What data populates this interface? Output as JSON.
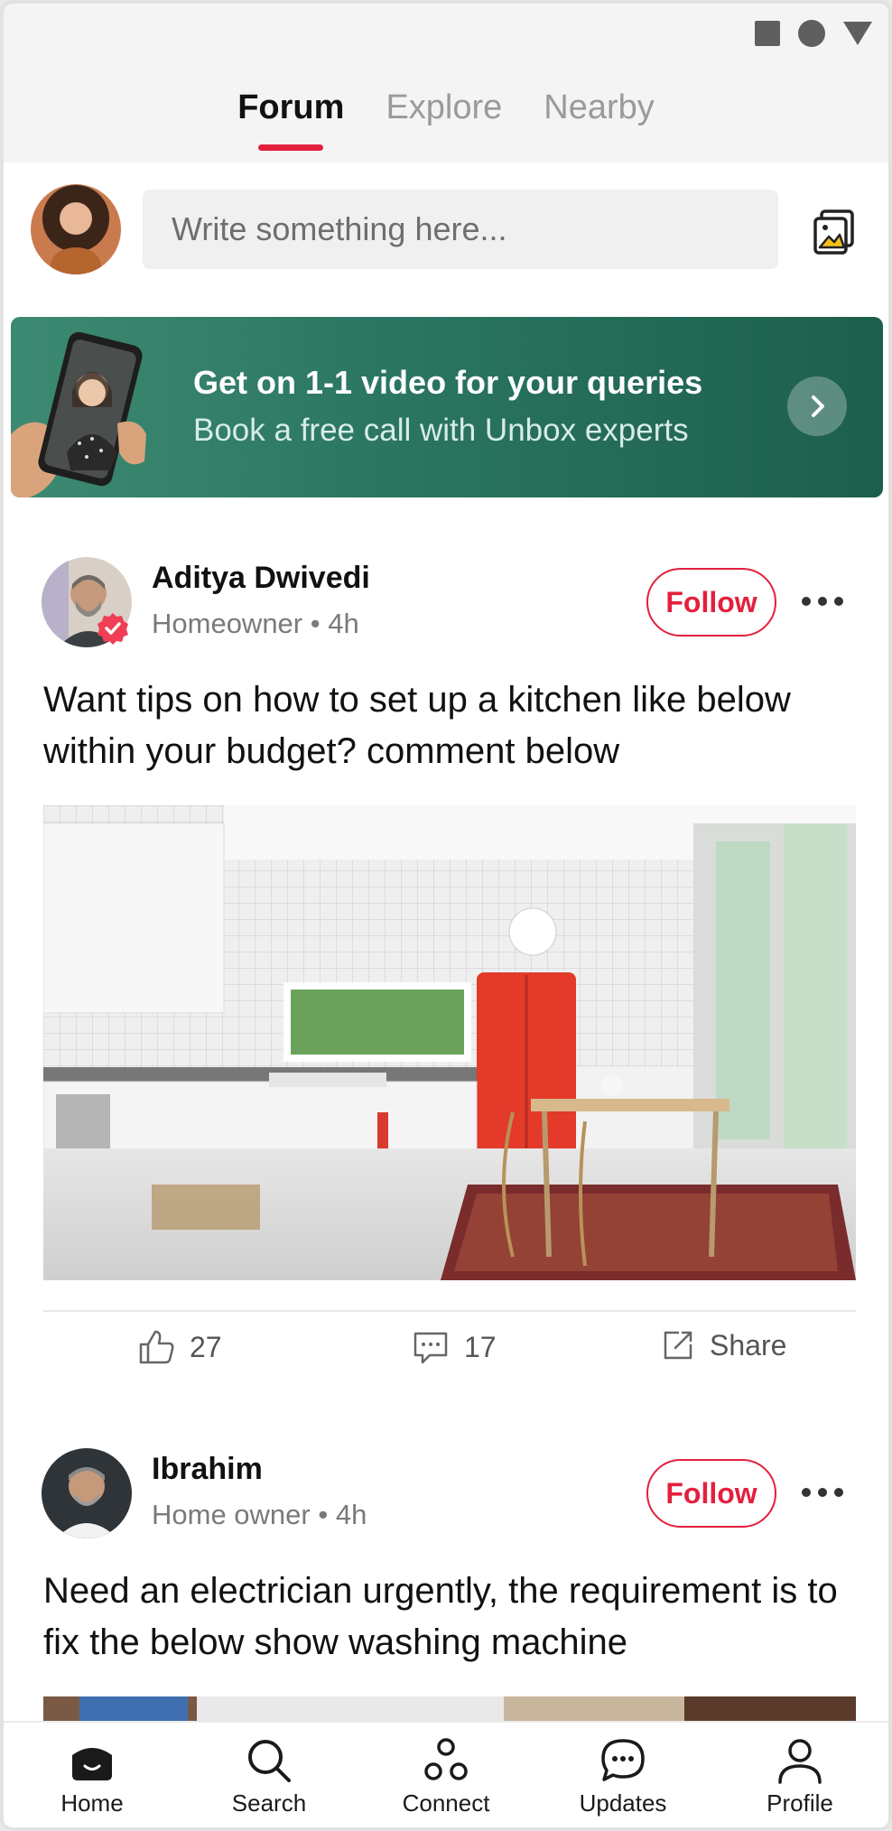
{
  "top_tabs": [
    {
      "label": "Forum"
    },
    {
      "label": "Explore"
    },
    {
      "label": "Nearby"
    }
  ],
  "composer": {
    "placeholder": "Write something here..."
  },
  "promo": {
    "title": "Get on 1-1 video for your queries",
    "subtitle": "Book a free call with Unbox experts"
  },
  "posts": [
    {
      "author": "Aditya Dwivedi",
      "role": "Homeowner",
      "time": "4h",
      "follow_label": "Follow",
      "text": "Want tips on how to set up a kitchen like below within your budget? comment below",
      "likes": "27",
      "comments": "17",
      "share_label": "Share"
    },
    {
      "author": "Ibrahim",
      "role": "Home owner",
      "time": "4h",
      "follow_label": "Follow",
      "text": "Need an electrician urgently, the requirement is to fix the below show washing machine"
    }
  ],
  "bottom_nav": [
    {
      "label": "Home"
    },
    {
      "label": "Search"
    },
    {
      "label": "Connect"
    },
    {
      "label": "Updates"
    },
    {
      "label": "Profile"
    }
  ],
  "colors": {
    "accent": "#e3203d",
    "promo_green": "#1d5f4d",
    "tab_inactive": "#9a9a9a"
  }
}
